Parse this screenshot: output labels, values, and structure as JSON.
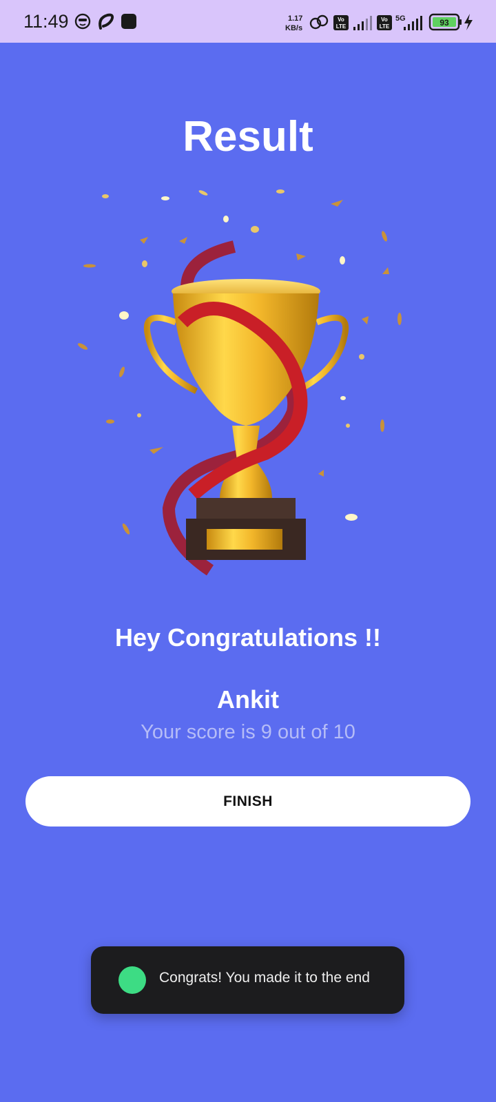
{
  "status_bar": {
    "time": "11:49",
    "net_speed_value": "1.17",
    "net_speed_unit": "KB/s",
    "sim1_label_top": "Vo",
    "sim1_label_bottom": "LTE",
    "sim2_label_top": "Vo",
    "sim2_label_bottom": "LTE",
    "network_type": "5G",
    "battery_level": "93",
    "icons": [
      "face-icon",
      "airtel-icon",
      "app-square-icon",
      "link-icon",
      "signal-icon",
      "signal-icon",
      "battery-icon",
      "charging-icon"
    ]
  },
  "page": {
    "title": "Result",
    "congrats_text": "Hey Congratulations !!",
    "user_name": "Ankit",
    "score_text": "Your score is 9 out of 10",
    "finish_label": "FINISH"
  },
  "toast": {
    "message": "Congrats! You made it to the end"
  },
  "colors": {
    "background": "#5b6cf0",
    "status_bar": "#d9c5fb",
    "button": "#ffffff",
    "toast": "#1c1c1e",
    "battery_fill": "#5fd15f"
  }
}
